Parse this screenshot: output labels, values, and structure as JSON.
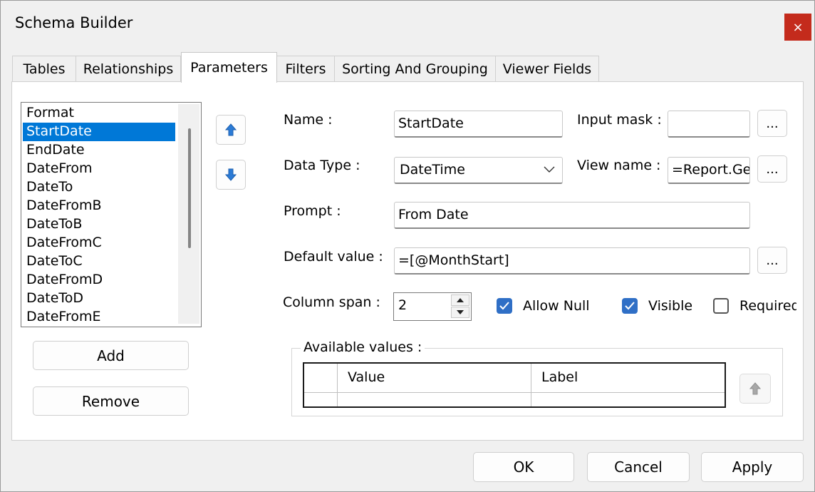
{
  "window": {
    "title": "Schema Builder",
    "close_glyph": "×"
  },
  "tabs": [
    {
      "label": "Tables"
    },
    {
      "label": "Relationships"
    },
    {
      "label": "Parameters"
    },
    {
      "label": "Filters"
    },
    {
      "label": "Sorting And Grouping"
    },
    {
      "label": "Viewer Fields"
    }
  ],
  "active_tab": "Parameters",
  "parameters_list": {
    "items": [
      "Format",
      "StartDate",
      "EndDate",
      "DateFrom",
      "DateTo",
      "DateFromB",
      "DateToB",
      "DateFromC",
      "DateToC",
      "DateFromD",
      "DateToD",
      "DateFromE"
    ],
    "selected": "StartDate"
  },
  "list_buttons": {
    "add": "Add",
    "remove": "Remove",
    "move_up_icon": "arrow-up-icon",
    "move_down_icon": "arrow-down-icon"
  },
  "form": {
    "name_label": "Name :",
    "name_value": "StartDate",
    "input_mask_label": "Input mask :",
    "input_mask_value": "",
    "data_type_label": "Data Type :",
    "data_type_value": "DateTime",
    "view_name_label": "View name :",
    "view_name_value": "=Report.Ge",
    "prompt_label": "Prompt :",
    "prompt_value": "From Date",
    "default_value_label": "Default value :",
    "default_value_value": "=[@MonthStart]",
    "column_span_label": "Column span :",
    "column_span_value": "2",
    "ellipsis": "..."
  },
  "checkboxes": [
    {
      "label": "Allow Null",
      "checked": true
    },
    {
      "label": "Visible",
      "checked": true
    },
    {
      "label": "Required",
      "checked": false
    }
  ],
  "available_values": {
    "title": "Available values :",
    "columns": [
      "Value",
      "Label"
    ]
  },
  "footer": {
    "ok": "OK",
    "cancel": "Cancel",
    "apply": "Apply"
  },
  "colors": {
    "accent": "#0078d7",
    "checkbox": "#2f6fc6",
    "close": "#c42b1c",
    "arrow": "#2b7bd6"
  }
}
